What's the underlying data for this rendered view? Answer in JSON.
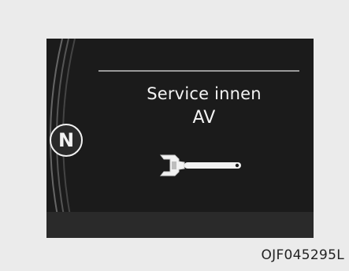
{
  "display": {
    "gear_indicator": "N",
    "message_line1": "Service innen",
    "message_line2": "AV",
    "icon": "wrench-icon"
  },
  "figure_code": "OJF045295L"
}
